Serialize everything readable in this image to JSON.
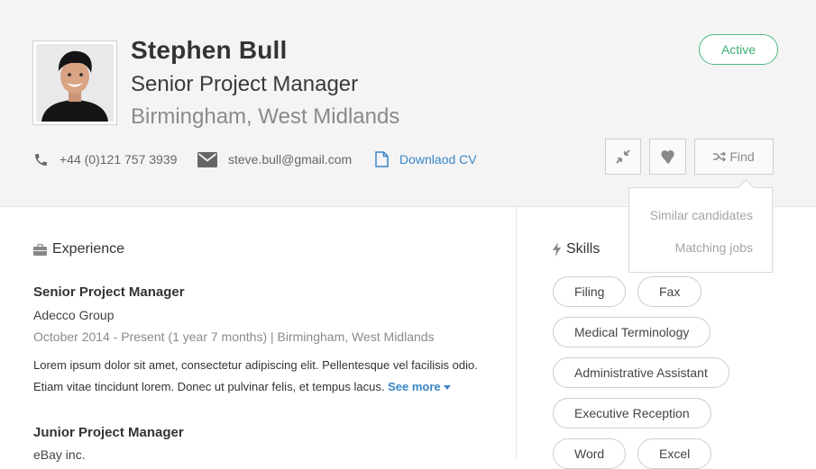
{
  "profile": {
    "name": "Stephen Bull",
    "title": "Senior Project Manager",
    "location": "Birmingham, West Midlands",
    "status": "Active",
    "phone": "+44 (0)121 757 3939",
    "email": "steve.bull@gmail.com",
    "cv_link": "Downlaod CV"
  },
  "actions": {
    "collapse_icon": "compress-icon",
    "favorite_icon": "heart-icon",
    "find_label": "Find",
    "find_icon": "shuffle-icon",
    "find_menu": [
      "Similar candidates",
      "Matching jobs"
    ]
  },
  "experience": {
    "heading": "Experience",
    "jobs": [
      {
        "title": "Senior Project Manager",
        "company": "Adecco Group",
        "meta": "October 2014 - Present (1 year 7 months) | Birmingham, West Midlands",
        "desc_line1": "Lorem ipsum dolor sit amet, consectetur adipiscing elit. Pellentesque vel facilisis odio.",
        "desc_line2": "Etiam vitae tincidunt lorem. Donec ut pulvinar felis, et tempus lacus.",
        "see_more": "See more"
      },
      {
        "title": "Junior Project Manager",
        "company": "eBay inc."
      }
    ]
  },
  "skills": {
    "heading": "Skills",
    "items": [
      "Filing",
      "Fax",
      "Medical Terminology",
      "Administrative Assistant",
      "Executive Reception",
      "Word",
      "Excel"
    ]
  },
  "colors": {
    "accent": "#3a86c8",
    "status": "#4cba7f",
    "header_bg": "#f4f4f4"
  }
}
